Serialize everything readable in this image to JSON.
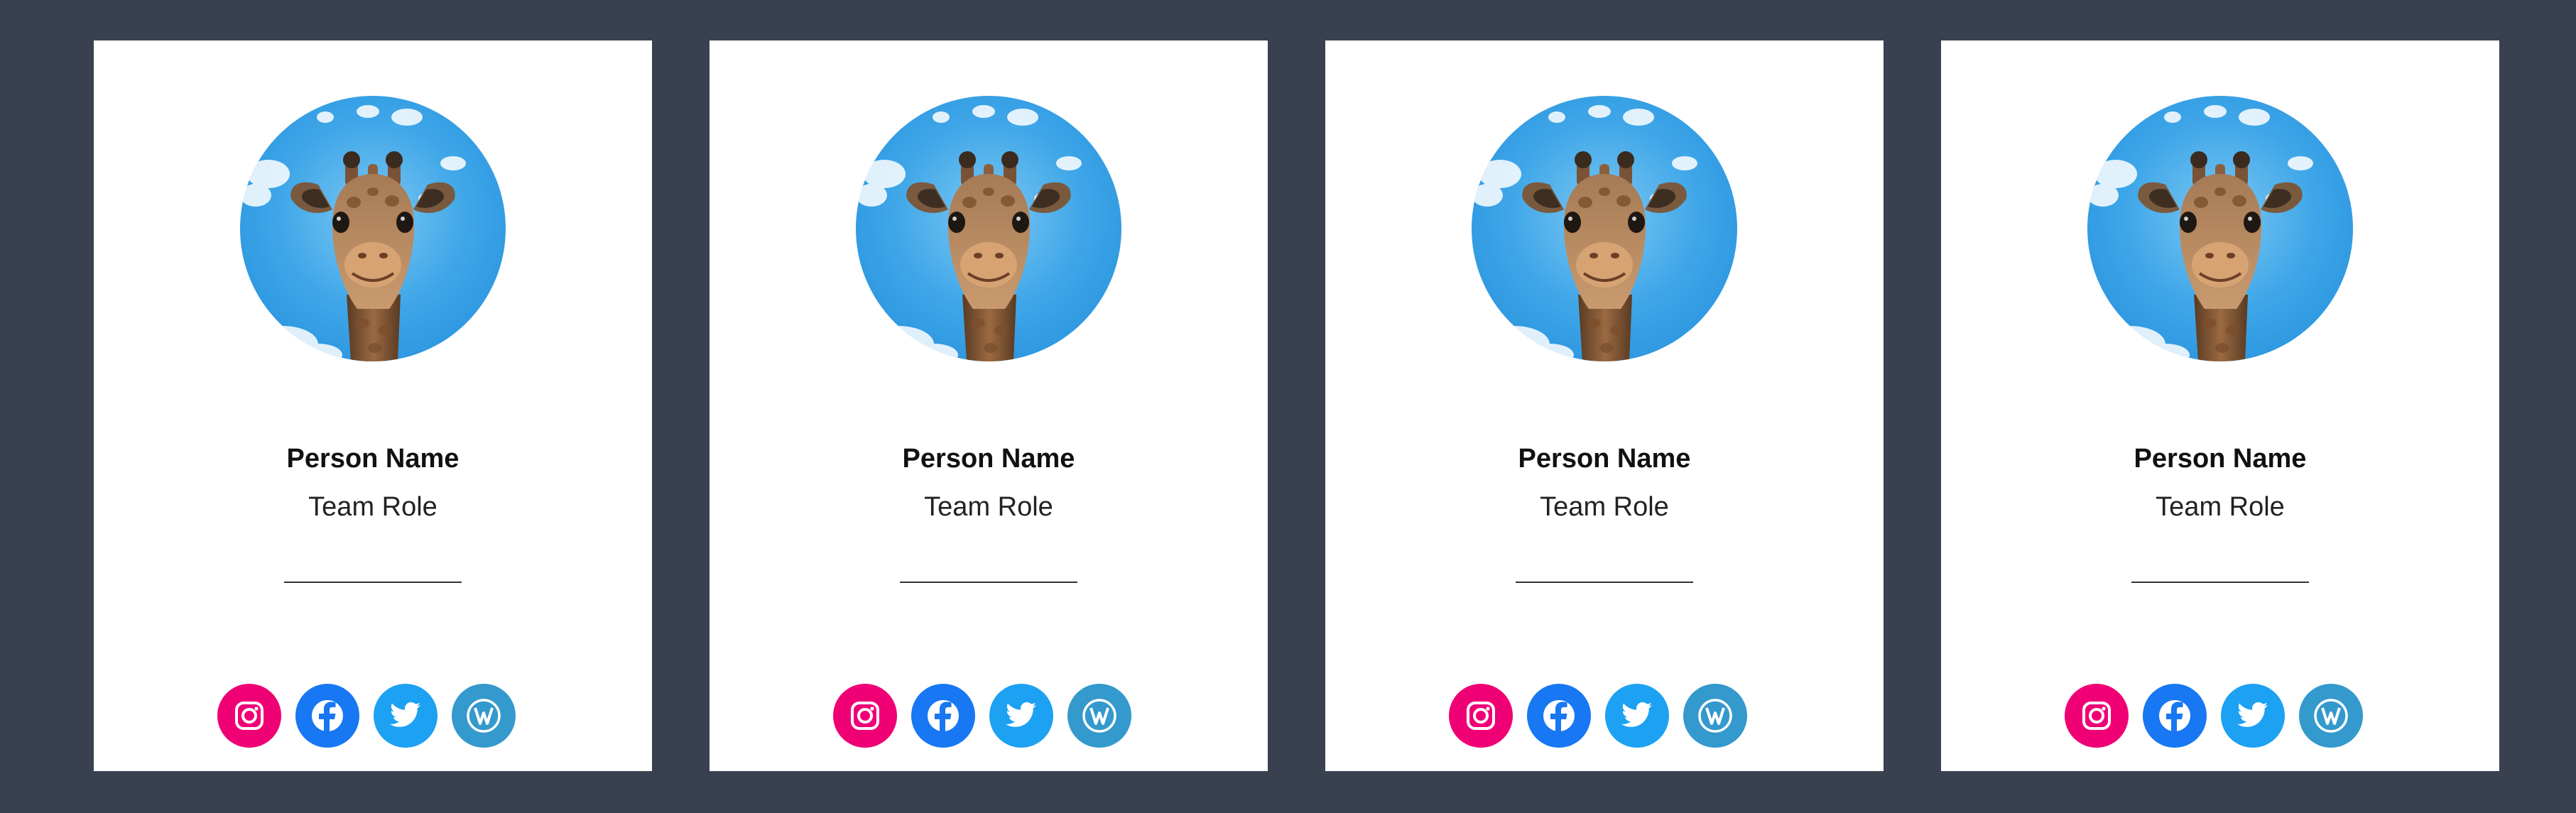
{
  "cards": [
    {
      "name": "Person Name",
      "role": "Team Role",
      "socials": [
        {
          "icon": "instagram-icon",
          "color": "#F00075"
        },
        {
          "icon": "facebook-icon",
          "color": "#1877F2"
        },
        {
          "icon": "twitter-icon",
          "color": "#1DA1F2"
        },
        {
          "icon": "wordpress-icon",
          "color": "#3499CD"
        }
      ]
    },
    {
      "name": "Person Name",
      "role": "Team Role",
      "socials": [
        {
          "icon": "instagram-icon",
          "color": "#F00075"
        },
        {
          "icon": "facebook-icon",
          "color": "#1877F2"
        },
        {
          "icon": "twitter-icon",
          "color": "#1DA1F2"
        },
        {
          "icon": "wordpress-icon",
          "color": "#3499CD"
        }
      ]
    },
    {
      "name": "Person Name",
      "role": "Team Role",
      "socials": [
        {
          "icon": "instagram-icon",
          "color": "#F00075"
        },
        {
          "icon": "facebook-icon",
          "color": "#1877F2"
        },
        {
          "icon": "twitter-icon",
          "color": "#1DA1F2"
        },
        {
          "icon": "wordpress-icon",
          "color": "#3499CD"
        }
      ]
    },
    {
      "name": "Person Name",
      "role": "Team Role",
      "socials": [
        {
          "icon": "instagram-icon",
          "color": "#F00075"
        },
        {
          "icon": "facebook-icon",
          "color": "#1877F2"
        },
        {
          "icon": "twitter-icon",
          "color": "#1DA1F2"
        },
        {
          "icon": "wordpress-icon",
          "color": "#3499CD"
        }
      ]
    }
  ],
  "colors": {
    "page_background": "#394150",
    "card_background": "#FFFFFF",
    "sky": "#3AA6E8"
  }
}
